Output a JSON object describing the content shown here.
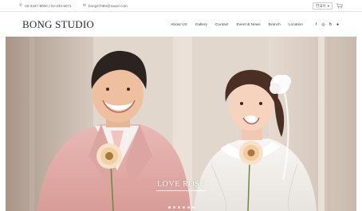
{
  "topbar": {
    "phone": "02-3447-8000 / 02-344-5071",
    "email": "bong47088@naver.com",
    "language": "한국어",
    "language_chevron": "▾"
  },
  "header": {
    "logo": "BONG STUDIO",
    "nav": [
      {
        "label": "About US"
      },
      {
        "label": "Gallery"
      },
      {
        "label": "Contact"
      },
      {
        "label": "Event & News"
      },
      {
        "label": "Branch"
      },
      {
        "label": "Location"
      }
    ],
    "social": [
      {
        "icon": "facebook-icon",
        "glyph": "f"
      },
      {
        "icon": "instagram-icon",
        "glyph": "◎"
      },
      {
        "icon": "blog-icon",
        "glyph": "b"
      },
      {
        "icon": "kakao-icon",
        "glyph": "●"
      }
    ]
  },
  "hero": {
    "title": "LOVE ROSE",
    "slide_count": 6,
    "active_slide": 1
  }
}
